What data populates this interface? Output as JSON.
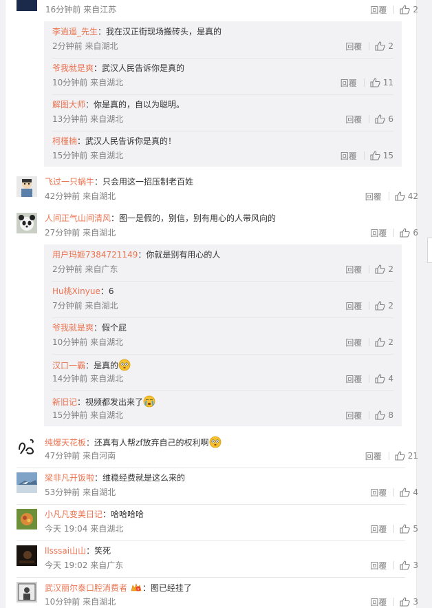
{
  "reply_label": "回覆",
  "top_partial": {
    "time": "16分钟前",
    "location": "来自江苏",
    "likes": "2"
  },
  "group1": [
    {
      "name": "李逍遥_先生",
      "text": "：我在汉正街现场搬砖头，是真的",
      "time": "2分钟前",
      "location": "来自湖北",
      "likes": "2"
    },
    {
      "name": "爷我就是爽",
      "text": "：武汉人民告诉你是真的",
      "time": "10分钟前",
      "location": "来自湖北",
      "likes": "11"
    },
    {
      "name": "解图大师",
      "text": "：你是真的，自以为聪明。",
      "time": "13分钟前",
      "location": "来自湖北",
      "likes": "6"
    },
    {
      "name": "柯槿楠",
      "text": "：武汉人民告诉你是真的！",
      "time": "15分钟前",
      "location": "来自湖北",
      "likes": "15"
    }
  ],
  "c1": {
    "name": "飞过一只蜗牛",
    "text": "：只会用这一招压制老百姓",
    "time": "42分钟前",
    "location": "来自湖北",
    "likes": "42",
    "avatar_icon": "cartoon-avatar-icon"
  },
  "c2": {
    "name": "人间正气山间清风",
    "text": "：图一是假的，别信，别有用心的人带风向的",
    "time": "27分钟前",
    "location": "来自湖北",
    "likes": "6",
    "avatar_icon": "panda-avatar-icon"
  },
  "group2": [
    {
      "name": "用户玛姬7384721149",
      "text": "：你就是别有用心的人",
      "time": "2分钟前",
      "location": "来自广东",
      "likes": "2"
    },
    {
      "name": "Hu桃Xinyue",
      "text": "：6",
      "time": "7分钟前",
      "location": "来自湖北",
      "likes": "2"
    },
    {
      "name": "爷我就是爽",
      "text": "：假个屁",
      "time": "10分钟前",
      "location": "来自湖北",
      "likes": "2"
    },
    {
      "name": "汉口一霸",
      "text": "：是真的",
      "time": "14分钟前",
      "location": "来自湖北",
      "likes": "4",
      "emoji": "flushed-emoji"
    },
    {
      "name": "新旧记",
      "text": "：视频都发出来了",
      "time": "15分钟前",
      "location": "来自湖北",
      "likes": "8",
      "emoji": "crying-emoji"
    }
  ],
  "c3": {
    "name": "纯爆天花板",
    "text": "：还真有人帮zf放弃自己的权利啊",
    "time": "47分钟前",
    "location": "来自河南",
    "likes": "21",
    "emoji": "flushed-emoji",
    "avatar_icon": "doodle-avatar-icon"
  },
  "c4": {
    "name": "梁非凡开饭啦",
    "text": "：维稳经费就是这么来的",
    "time": "53分钟前",
    "location": "来自湖北",
    "likes": "4",
    "avatar_icon": "landscape-avatar-icon"
  },
  "c5": {
    "name": "小凡凡变美日记",
    "text": "：哈哈哈哈",
    "time": "今天 19:04",
    "location": "来自湖北",
    "likes": "5",
    "avatar_icon": "food-avatar-icon"
  },
  "c6": {
    "name": "llsssai山山",
    "text": "：笑死",
    "time": "今天 19:02",
    "location": "来自广东",
    "likes": "3",
    "avatar_icon": "dark-avatar-icon"
  },
  "c7": {
    "name": "武汉丽尔泰口腔消费者",
    "text": "：图已经挂了",
    "time": "10分钟前",
    "location": "来自湖北",
    "likes": "3",
    "avatar_icon": "person-avatar-icon",
    "badge_icon": "vip-badge-icon"
  },
  "colors": {
    "name": "#eb7350",
    "meta": "#808080",
    "sub_bg": "#f2f2f5",
    "panel_bg": "#ffffff"
  }
}
